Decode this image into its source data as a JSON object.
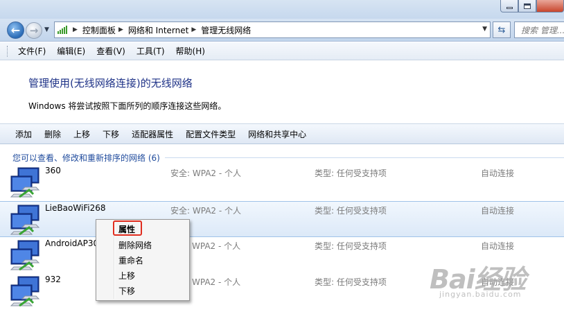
{
  "window": {
    "controls": [
      "minimize",
      "maximize",
      "close"
    ]
  },
  "address_bar": {
    "breadcrumbs": [
      "控制面板",
      "网络和 Internet",
      "管理无线网络"
    ],
    "search_placeholder": "搜索 管理..."
  },
  "menu": {
    "items": [
      "文件(F)",
      "编辑(E)",
      "查看(V)",
      "工具(T)",
      "帮助(H)"
    ]
  },
  "header": {
    "title": "管理使用(无线网络连接)的无线网络",
    "description": "Windows 将尝试按照下面所列的顺序连接这些网络。"
  },
  "commands": [
    "添加",
    "删除",
    "上移",
    "下移",
    "适配器属性",
    "配置文件类型",
    "网络和共享中心"
  ],
  "group": {
    "label": "您可以查看、修改和重新排序的网络 (6)"
  },
  "networks": [
    {
      "name": "360",
      "security": "安全: WPA2 - 个人",
      "type": "类型: 任何受支持项",
      "mode": "自动连接"
    },
    {
      "name": "LieBaoWiFi268",
      "security": "安全: WPA2 - 个人",
      "type": "类型: 任何受支持项",
      "mode": "自动连接"
    },
    {
      "name": "AndroidAP30",
      "security": "WPA2 - 个人",
      "type": "类型: 任何受支持项",
      "mode": "自动连接"
    },
    {
      "name": "932",
      "security": "WPA2 - 个人",
      "type": "类型: 任何受支持项",
      "mode": "自动连接"
    }
  ],
  "context_menu": {
    "items": [
      "属性",
      "删除网络",
      "重命名",
      "上移",
      "下移"
    ],
    "highlighted": "属性"
  },
  "watermark": {
    "logo": "Bai经验",
    "url": "jingyan.baidu.com"
  },
  "colors": {
    "title_blue": "#1e3287",
    "group_blue": "#1e4a9c",
    "highlight_red": "#e02c1e"
  }
}
